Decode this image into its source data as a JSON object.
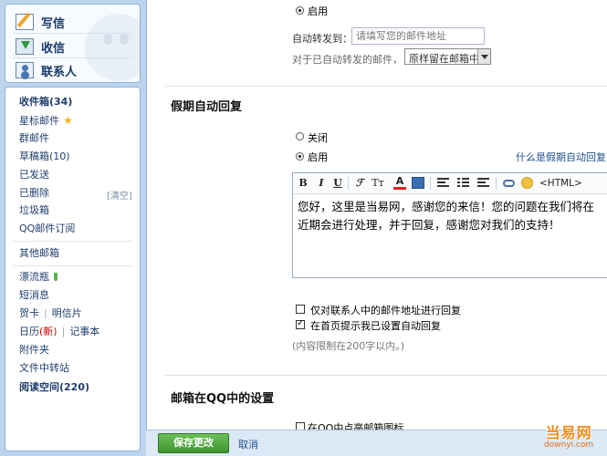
{
  "sidebar": {
    "quick_actions": [
      {
        "label": "写信",
        "icon": "pencil-write-icon"
      },
      {
        "label": "收信",
        "icon": "inbox-download-icon"
      },
      {
        "label": "联系人",
        "icon": "contacts-icon"
      }
    ],
    "folders": {
      "inbox": {
        "label": "收件箱",
        "count": "(34)"
      },
      "starred": {
        "label": "星标邮件",
        "icon": "star-icon"
      },
      "group": "群邮件",
      "drafts": {
        "label": "草稿箱",
        "count": "(10)"
      },
      "sent": "已发送",
      "deleted": "已删除",
      "clear": "[清空]",
      "spam": "垃圾箱",
      "subscriptions": "QQ邮件订阅",
      "other": "其他邮箱",
      "drift_bottle": {
        "label": "漂流瓶",
        "icon": "bottle-icon"
      },
      "sms": "短消息",
      "cards": "贺卡",
      "postcards": "明信片",
      "calendar": "日历",
      "calendar_new": "(新)",
      "notes": "记事本",
      "attachments": "附件夹",
      "file_transfer": "文件中转站",
      "reading": {
        "label": "阅读空间",
        "count": "(220)"
      }
    }
  },
  "forward": {
    "enable_label": "启用",
    "address_label": "自动转发到：",
    "address_placeholder": "请填写您的邮件地址",
    "keep_label": "对于已自动转发的邮件，",
    "keep_option": "原样留在邮箱中"
  },
  "auto_reply": {
    "title": "假期自动回复",
    "off_label": "关闭",
    "on_label": "启用",
    "help_link": "什么是假期自动回复?",
    "toolbar": {
      "bold": "B",
      "italic": "I",
      "underline": "U",
      "html": "<HTML>"
    },
    "message": "您好，这里是当易网，感谢您的来信！您的问题在我们将在近期会进行处理，并于回复，感谢您对我们的支持！",
    "opt_contacts_only": "仅对联系人中的邮件地址进行回复",
    "opt_show_notice": "在首页提示我已设置自动回复",
    "limit_note": "(内容限制在200字以内。)",
    "opt_show_notice_checked": true,
    "opt_contacts_only_checked": false
  },
  "qq_settings": {
    "title": "邮箱在QQ中的设置",
    "partial_option": "在QQ中点亮邮箱图标"
  },
  "actions": {
    "save": "保存更改",
    "cancel": "取消"
  },
  "watermark": {
    "cn": "当易网",
    "en": "downyi.com"
  },
  "colors": {
    "background": "#bcd4ee",
    "link": "#1f4f8c",
    "save_button": "#4aa63b",
    "watermark": "#f08a1a"
  }
}
